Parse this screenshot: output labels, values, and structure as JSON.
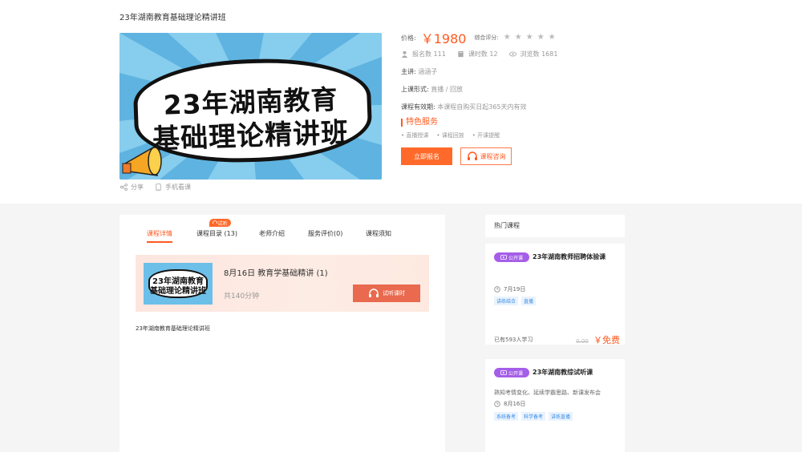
{
  "crumb": "23年湖南教育基础理论精讲班",
  "banner": {
    "line1": "23年湖南教育",
    "line2": "基础理论精讲班",
    "bg_color": "#6cbfe8"
  },
  "share": {
    "share_label": "分享",
    "mobile_label": "手机看课"
  },
  "info": {
    "price_label": "价格:",
    "price": "￥1980",
    "rating_label": "综合评分:",
    "stars": 5,
    "enroll_label": "报名数 111",
    "hours_label": "课时数 12",
    "views_label": "浏览数 1681",
    "lecturer_key": "主讲:",
    "lecturer_val": "涵涵子",
    "mode_key": "上课形式:",
    "mode_val": "直播 / 回放",
    "valid_key": "课程有效期:",
    "valid_val": "本课程自购买日起365天内有效",
    "features_title": "特色服务",
    "features": [
      "• 直播授课",
      "• 课程回放",
      "• 开课提醒"
    ],
    "signup_label": "立即报名",
    "consult_label": "课程咨询"
  },
  "tabs": {
    "items": [
      "课程详情",
      "课程目录 (13)",
      "老师介绍",
      "服务评价(0)",
      "课程须知"
    ],
    "trial_badge": "试听",
    "active": 0
  },
  "lesson": {
    "thumb_line1": "23年湖南教育",
    "thumb_line2": "基础理论精讲班",
    "title": "8月16日 教育学基础精讲 (1)",
    "duration": "共140分钟",
    "trial_btn": "试听课时"
  },
  "desc": "23年湖南教育基础理论精讲班",
  "side": {
    "heading": "热门课程",
    "cards": [
      {
        "tag": "公开课",
        "title": "23年湖南教师招聘体验课",
        "date": "7月19日",
        "chips": [
          "讲练结合",
          "直播"
        ],
        "learners": "已有593人学习",
        "old_price": "0.00",
        "price": "￥免费"
      },
      {
        "tag": "公开课",
        "title": "23年湖南教综试听课",
        "subtitle": "熟知考情变化、延续学霸思路、新课发布会",
        "date": "8月16日",
        "chips": [
          "系统备考",
          "科学备考",
          "讲练直播"
        ]
      }
    ]
  },
  "colors": {
    "accent": "#ff5a1f",
    "tag_purple": "#a55ee8",
    "chip_blue": "#3a8ee6"
  }
}
